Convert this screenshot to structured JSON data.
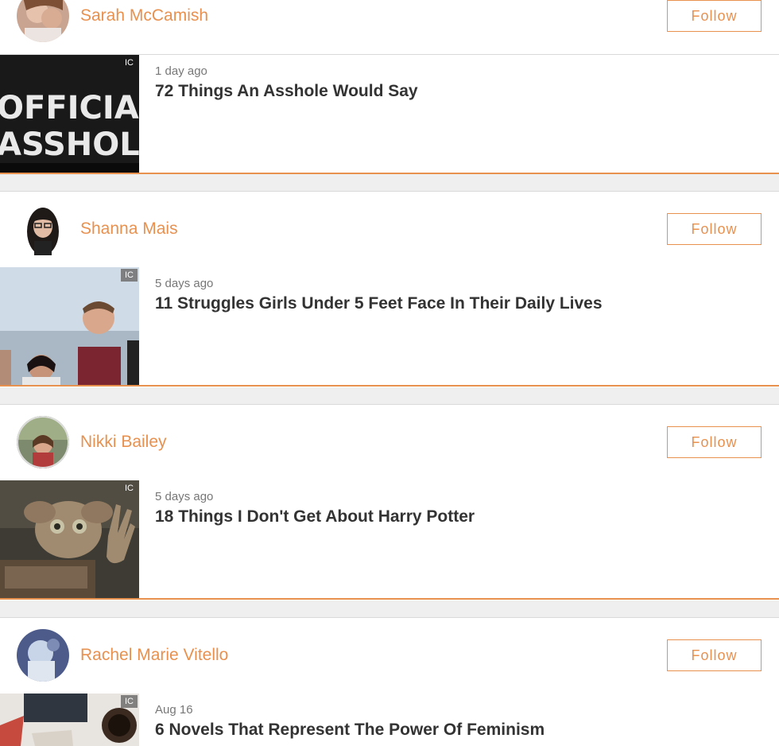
{
  "feed": [
    {
      "author": "Sarah McCamish",
      "follow_label": "Follow",
      "time": "1 day ago",
      "title": "72 Things An Asshole Would Say",
      "badge": "IC",
      "thumb_text": [
        "OFFICIAL",
        "ASSHOLE"
      ]
    },
    {
      "author": "Shanna Mais",
      "follow_label": "Follow",
      "time": "5 days ago",
      "title": "11 Struggles Girls Under 5 Feet Face In Their Daily Lives",
      "badge": "IC"
    },
    {
      "author": "Nikki Bailey",
      "follow_label": "Follow",
      "time": "5 days ago",
      "title": "18 Things I Don't Get About Harry Potter",
      "badge": "IC"
    },
    {
      "author": "Rachel Marie Vitello",
      "follow_label": "Follow",
      "time": "Aug 16",
      "title": "6 Novels That Represent The Power Of Feminism",
      "badge": "IC"
    }
  ],
  "colors": {
    "accent": "#e8914f",
    "separator": "#efefef",
    "title_text": "#333333",
    "meta_text": "#777777"
  }
}
